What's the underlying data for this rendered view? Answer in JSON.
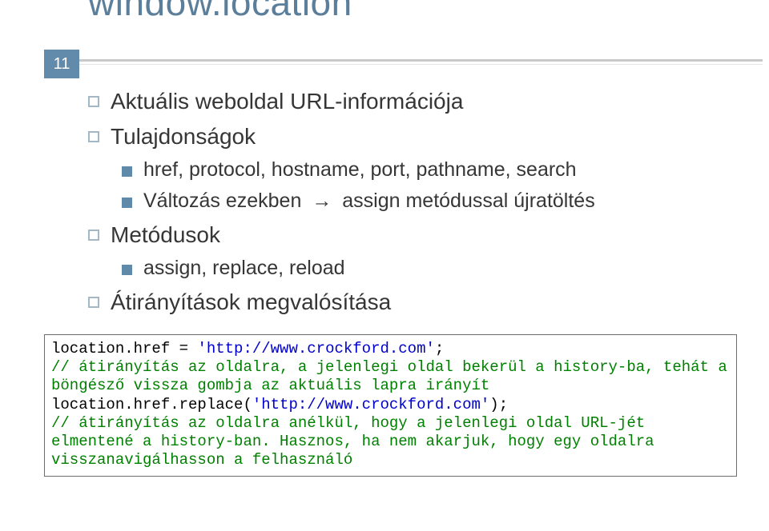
{
  "page_number": "11",
  "title": "window.location",
  "bullets": {
    "b1": "Aktuális weboldal URL-információja",
    "b2": "Tulajdonságok",
    "b2a": "href, protocol, hostname, port, pathname, search",
    "b2b_pre": "Változás ezekben",
    "b2b_post": "assign metódussal újratöltés",
    "b3": "Metódusok",
    "b3a": "assign, replace, reload",
    "b4": "Átirányítások megvalósítása"
  },
  "arrow": "→",
  "code": {
    "l1a": "location.href = ",
    "l1b": "'http://www.crockford.com'",
    "l1c": ";",
    "l2": "// átirányítás az oldalra, a jelenlegi oldal bekerül a history-ba, tehát a böngésző vissza gombja az aktuális lapra irányít",
    "l3a": "location.href.replace(",
    "l3b": "'http://www.crockford.com'",
    "l3c": ");",
    "l4": "// átirányítás az oldalra anélkül, hogy a jelenlegi oldal URL-jét elmentené a history-ban. Hasznos, ha nem akarjuk, hogy egy oldalra visszanavigálhasson a felhasználó"
  }
}
